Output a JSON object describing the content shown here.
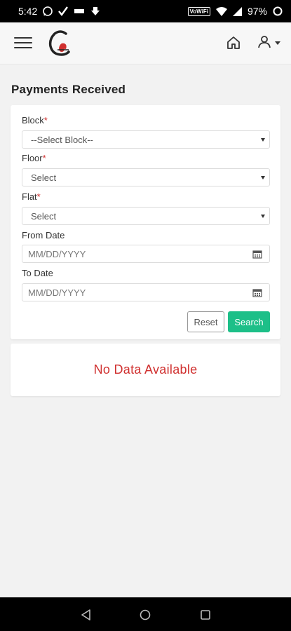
{
  "status_bar": {
    "time": "5:42",
    "battery": "97%",
    "vowifi": "VoWiFi"
  },
  "app_bar": {
    "menu_icon": "hamburger-icon",
    "logo_icon": "app-logo",
    "home_icon": "home-icon",
    "user_icon": "user-icon"
  },
  "page": {
    "title": "Payments Received"
  },
  "form": {
    "block": {
      "label": "Block",
      "required": "*",
      "value": "--Select Block--"
    },
    "floor": {
      "label": "Floor",
      "required": "*",
      "value": "Select"
    },
    "flat": {
      "label": "Flat",
      "required": "*",
      "value": "Select"
    },
    "from_date": {
      "label": "From Date",
      "placeholder": "MM/DD/YYYY"
    },
    "to_date": {
      "label": "To Date",
      "placeholder": "MM/DD/YYYY"
    },
    "reset_label": "Reset",
    "search_label": "Search"
  },
  "results": {
    "empty_message": "No Data Available"
  },
  "colors": {
    "accent": "#1dbf88",
    "error": "#d0302f"
  }
}
